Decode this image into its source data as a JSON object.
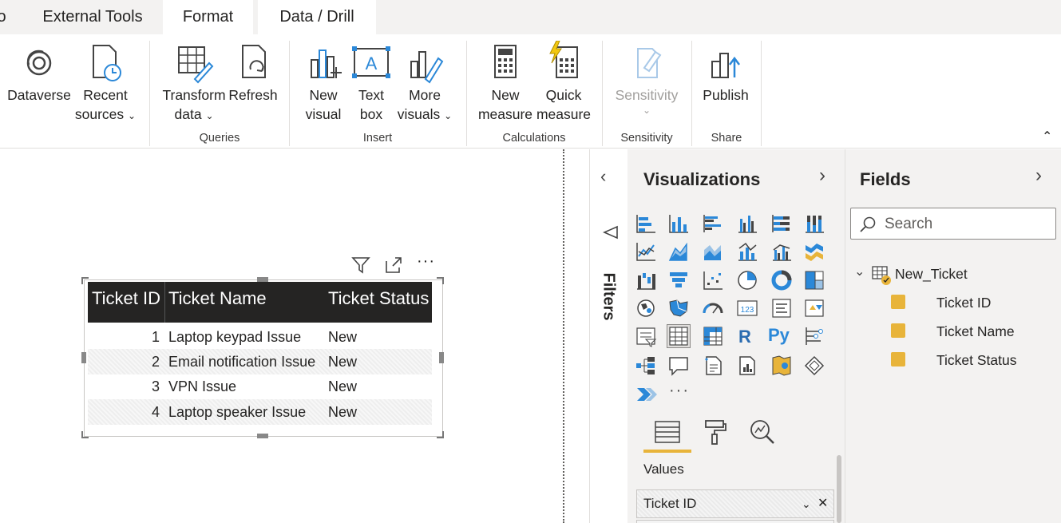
{
  "tabs": [
    {
      "label": "o"
    },
    {
      "label": "External Tools"
    },
    {
      "label": "Format"
    },
    {
      "label": "Data / Drill"
    }
  ],
  "ribbon": {
    "buttons": {
      "dataverse": "Dataverse",
      "recent_sources_1": "Recent",
      "recent_sources_2": "sources",
      "transform_1": "Transform",
      "transform_2": "data",
      "refresh": "Refresh",
      "new_visual_1": "New",
      "new_visual_2": "visual",
      "text_box_1": "Text",
      "text_box_2": "box",
      "more_visuals_1": "More",
      "more_visuals_2": "visuals",
      "new_measure_1": "New",
      "new_measure_2": "measure",
      "quick_measure_1": "Quick",
      "quick_measure_2": "measure",
      "sensitivity": "Sensitivity",
      "publish": "Publish"
    },
    "groups": {
      "queries": "Queries",
      "insert": "Insert",
      "calculations": "Calculations",
      "sensitivity": "Sensitivity",
      "share": "Share"
    }
  },
  "table_visual": {
    "columns": [
      "Ticket ID",
      "Ticket Name",
      "Ticket Status"
    ],
    "rows": [
      {
        "id": "1",
        "name": "Laptop keypad Issue",
        "status": "New"
      },
      {
        "id": "2",
        "name": "Email notification Issue",
        "status": "New"
      },
      {
        "id": "3",
        "name": "VPN Issue",
        "status": "New"
      },
      {
        "id": "4",
        "name": "Laptop speaker Issue",
        "status": "New"
      }
    ],
    "header_bg": "#252423"
  },
  "filters": {
    "label": "Filters"
  },
  "visualizations": {
    "title": "Visualizations",
    "more": "···",
    "values_label": "Values",
    "field_well": "Ticket ID",
    "icon_r": "R",
    "icon_py": "Py",
    "icon_123": "123"
  },
  "fields": {
    "title": "Fields",
    "search_placeholder": "Search",
    "table_name": "New_Ticket",
    "items": [
      "Ticket ID",
      "Ticket Name",
      "Ticket Status"
    ],
    "check_color": "#e8b43a"
  }
}
